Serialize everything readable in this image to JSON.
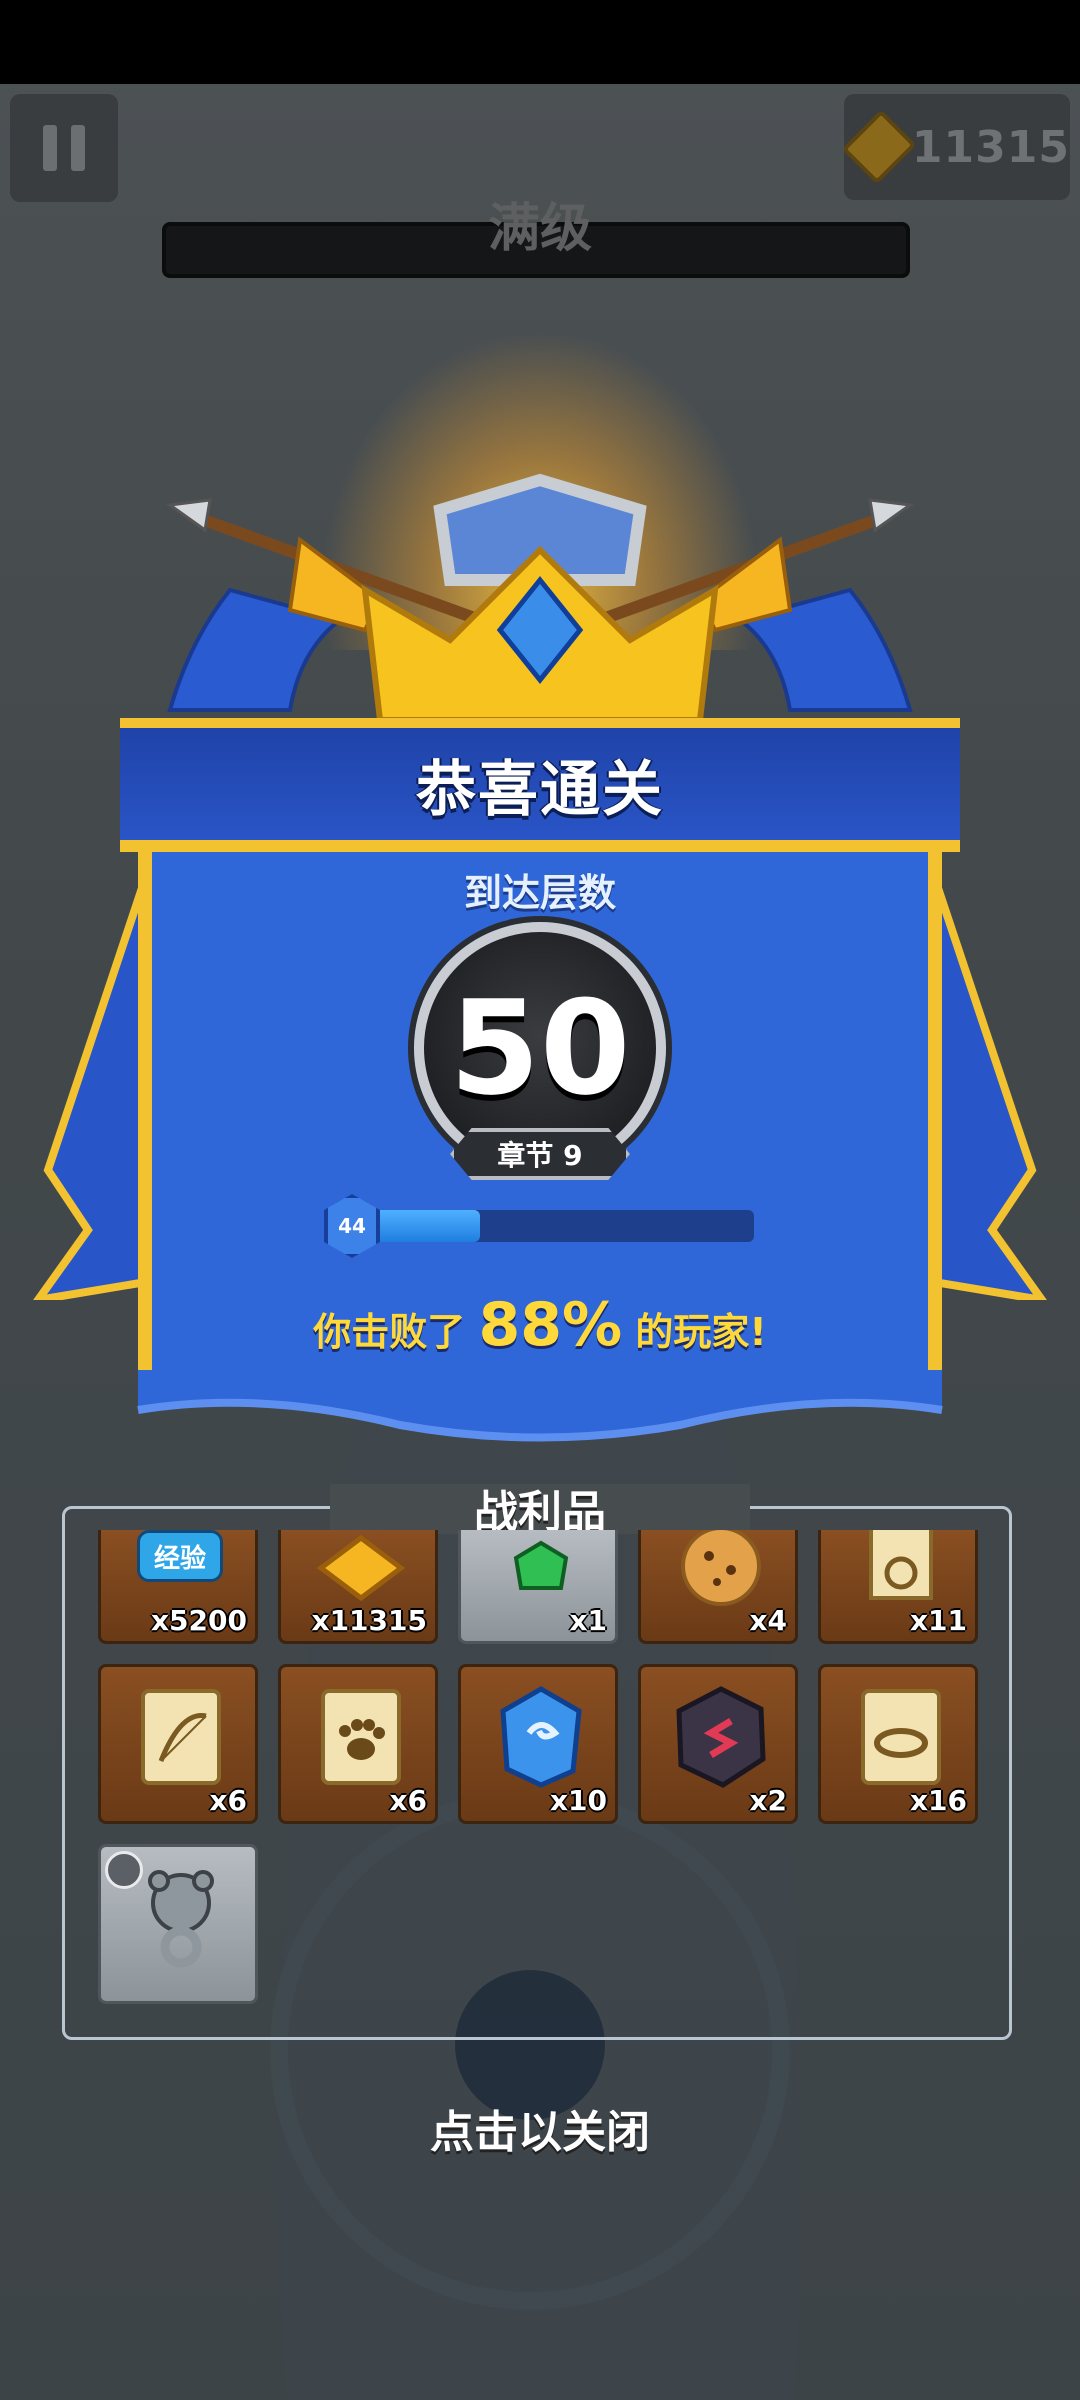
{
  "hud": {
    "gold_amount": "11315",
    "level_label": "满级",
    "gold_icon": "gold-coin-icon",
    "pause_icon": "pause-icon"
  },
  "result": {
    "title": "恭喜通关",
    "floor_label": "到达层数",
    "floor_number": "50",
    "chapter": "章节 9",
    "hero_level": "44",
    "hero_progress": 0.3,
    "defeat_prefix": "你击败了",
    "defeat_percent": "88%",
    "defeat_suffix": "的玩家!"
  },
  "loot": {
    "title": "战利品",
    "items": [
      {
        "name": "经验",
        "icon": "xp-badge-icon",
        "count": "x5200"
      },
      {
        "icon": "bow-scroll-gold-icon",
        "count": "x11315"
      },
      {
        "icon": "green-gem-icon",
        "count": "x1"
      },
      {
        "icon": "cookie-icon",
        "count": "x4"
      },
      {
        "icon": "ring-scroll-icon",
        "count": "x11"
      },
      {
        "icon": "bow-scroll-icon",
        "count": "x6"
      },
      {
        "icon": "paw-scroll-icon",
        "count": "x6"
      },
      {
        "icon": "blue-crystal-icon",
        "count": "x10"
      },
      {
        "icon": "dark-rune-stone-icon",
        "count": "x2"
      },
      {
        "icon": "bracelet-scroll-icon",
        "count": "x16"
      },
      {
        "icon": "bear-ring-icon",
        "count": ""
      }
    ]
  },
  "close_hint": "点击以关闭",
  "colors": {
    "banner_blue": "#2f66d8",
    "banner_gold": "#f2c230",
    "highlight_yellow": "#ffd93a",
    "slot_brown": "#7a4519"
  }
}
